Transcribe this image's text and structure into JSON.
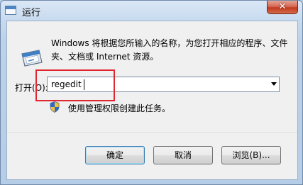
{
  "window": {
    "title": "运行",
    "close_symbol": "✕"
  },
  "dialog": {
    "description": "Windows 将根据您所输入的名称，为您打开相应的程序、文件夹、文档或 Internet 资源。",
    "open_label": "打开(O):",
    "command_value": "regedit",
    "admin_note": "使用管理权限创建此任务。"
  },
  "buttons": {
    "ok": "确定",
    "cancel": "取消",
    "browse": "浏览(B)..."
  },
  "icons": [
    "run-icon",
    "shield-icon",
    "dropdown-arrow-icon",
    "close-icon"
  ],
  "annotation": {
    "highlight_color": "#e0262e"
  }
}
